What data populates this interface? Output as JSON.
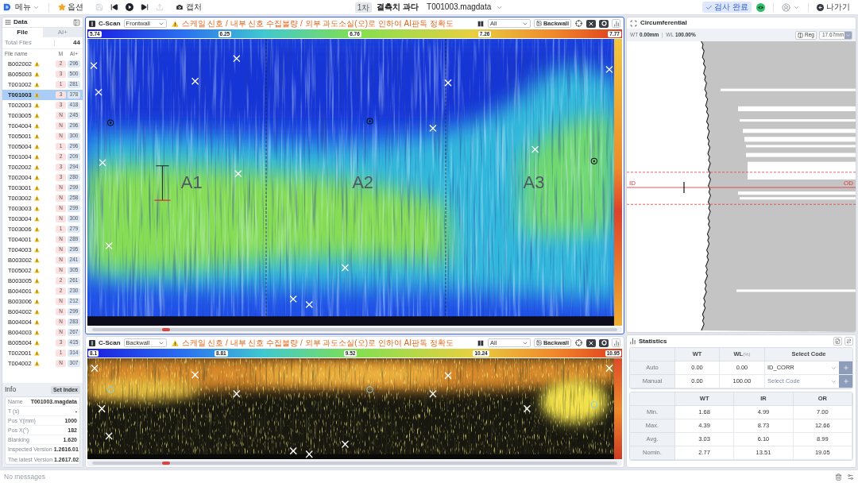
{
  "top_bar": {
    "menu_label": "메뉴",
    "options_label": "옵션",
    "tools": [
      {
        "kind": "save",
        "disabled": true
      },
      {
        "kind": "first",
        "disabled": false
      },
      {
        "kind": "play",
        "disabled": false
      },
      {
        "kind": "last",
        "disabled": false
      },
      {
        "kind": "export",
        "disabled": true
      }
    ],
    "capture_label": "캡처",
    "round_badge": "1차",
    "status_title": "결측치 과다",
    "file_name": "T001003.magdata",
    "complete_button": "검사 완료",
    "exit_button": "나가기"
  },
  "data_panel": {
    "title": "Data",
    "tabs": [
      {
        "label": "File",
        "selected": true
      },
      {
        "label": "AI+",
        "selected": false
      }
    ],
    "total_label": "Total Files",
    "total_count": "44",
    "columns": [
      "File name",
      "M",
      "AI+"
    ],
    "files": [
      {
        "name": "B002002",
        "warning": true,
        "m": "2",
        "ai": "296",
        "selected": false
      },
      {
        "name": "B005003",
        "warning": true,
        "m": "3",
        "ai": "500",
        "selected": false
      },
      {
        "name": "T001002",
        "warning": true,
        "m": "1",
        "ai": "281",
        "selected": false
      },
      {
        "name": "T001003",
        "warning": true,
        "m": "3",
        "ai": "378",
        "selected": true
      },
      {
        "name": "T002003",
        "warning": true,
        "m": "3",
        "ai": "418",
        "selected": false
      },
      {
        "name": "T003005",
        "warning": true,
        "m": "N",
        "ai": "245",
        "selected": false
      },
      {
        "name": "T004004",
        "warning": true,
        "m": "N",
        "ai": "296",
        "selected": false
      },
      {
        "name": "T005001",
        "warning": true,
        "m": "N",
        "ai": "300",
        "selected": false
      },
      {
        "name": "T005004",
        "warning": true,
        "m": "1",
        "ai": "296",
        "selected": false
      },
      {
        "name": "T001004",
        "warning": true,
        "m": "2",
        "ai": "209",
        "selected": false
      },
      {
        "name": "T002002",
        "warning": true,
        "m": "3",
        "ai": "294",
        "selected": false
      },
      {
        "name": "T002004",
        "warning": true,
        "m": "3",
        "ai": "280",
        "selected": false
      },
      {
        "name": "T003001",
        "warning": true,
        "m": "N",
        "ai": "299",
        "selected": false
      },
      {
        "name": "T003002",
        "warning": true,
        "m": "N",
        "ai": "258",
        "selected": false
      },
      {
        "name": "T003003",
        "warning": true,
        "m": "N",
        "ai": "299",
        "selected": false
      },
      {
        "name": "T003004",
        "warning": true,
        "m": "N",
        "ai": "300",
        "selected": false
      },
      {
        "name": "T003006",
        "warning": true,
        "m": "1",
        "ai": "279",
        "selected": false
      },
      {
        "name": "T004001",
        "warning": true,
        "m": "N",
        "ai": "289",
        "selected": false
      },
      {
        "name": "T004003",
        "warning": true,
        "m": "N",
        "ai": "295",
        "selected": false
      },
      {
        "name": "B003002",
        "warning": true,
        "m": "N",
        "ai": "241",
        "selected": false
      },
      {
        "name": "T005002",
        "warning": true,
        "m": "N",
        "ai": "305",
        "selected": false
      },
      {
        "name": "B003005",
        "warning": true,
        "m": "2",
        "ai": "261",
        "selected": false
      },
      {
        "name": "B004001",
        "warning": true,
        "m": "2",
        "ai": "230",
        "selected": false
      },
      {
        "name": "B003006",
        "warning": true,
        "m": "N",
        "ai": "212",
        "selected": false
      },
      {
        "name": "B004002",
        "warning": true,
        "m": "N",
        "ai": "299",
        "selected": false
      },
      {
        "name": "B004004",
        "warning": true,
        "m": "N",
        "ai": "283",
        "selected": false
      },
      {
        "name": "B004003",
        "warning": true,
        "m": "N",
        "ai": "267",
        "selected": false
      },
      {
        "name": "B005004",
        "warning": true,
        "m": "3",
        "ai": "415",
        "selected": false
      },
      {
        "name": "T002001",
        "warning": true,
        "m": "1",
        "ai": "314",
        "selected": false
      },
      {
        "name": "T004002",
        "warning": true,
        "m": "N",
        "ai": "307",
        "selected": false
      }
    ]
  },
  "info": {
    "title": "Info",
    "button": "Set Index",
    "rows": [
      {
        "label": "Name",
        "value": "T001003.magdata"
      },
      {
        "label": "T (s)",
        "value": "-"
      },
      {
        "label": "Pos Y(mm)",
        "value": "1000"
      },
      {
        "label": "Pos X(°)",
        "value": "182"
      },
      {
        "label": "Blanking",
        "value": "1.620"
      },
      {
        "label": "Inspected Version",
        "value": "1.2616.01"
      },
      {
        "label": "The latest Version",
        "value": "1.2617.02"
      }
    ]
  },
  "c_scans": [
    {
      "title": "C-Scan",
      "mode": "Frontwall",
      "warning": "스케일 신호 / 내부 신호 수집불량 / 외부 과도소실(오)로 인하여 AI판독 정확도",
      "filter": "All",
      "toggle_button": "Backwall",
      "active": true,
      "kind": "cool",
      "scale": [
        "5.74",
        "6.25",
        "6.76",
        "7.26",
        "7.77"
      ],
      "zones": [
        "A1",
        "A2",
        "A3"
      ]
    },
    {
      "title": "C-Scan",
      "mode": "Backwall",
      "warning": "스케일 신호 / 내부 신호 수집불량 / 외부 과도소실(오)로 인하여 AI판독 정확도",
      "filter": "All",
      "toggle_button": "Backwall",
      "active": false,
      "kind": "warm",
      "scale": [
        "8.1",
        "8.81",
        "9.52",
        "10.24",
        "10.95"
      ]
    }
  ],
  "circumferential": {
    "title": "Circumferential",
    "wt_label": "WT",
    "wt_value": "0.00mm",
    "wl_label": "WL",
    "wl_value": "100.00%",
    "reg_button": "Reg",
    "depth_value": "17.67mm",
    "inner_label": "ID",
    "outer_label": "OD"
  },
  "statistics": {
    "title": "Statistics",
    "code_table": {
      "columns": [
        {
          "label": "WT"
        },
        {
          "label": "WL",
          "unit": "(%)"
        },
        {
          "label": "Select Code"
        }
      ],
      "rows": [
        {
          "label": "Auto",
          "wt": "0.00",
          "wl": "0.00",
          "code": "ID_CORR"
        },
        {
          "label": "Manual",
          "wt": "0.00",
          "wl": "100.00",
          "placeholder": "Select Code"
        }
      ]
    },
    "summary_table": {
      "columns": [
        "WT",
        "IR",
        "OR"
      ],
      "rows": [
        {
          "label": "Min.",
          "values": [
            "1.68",
            "4.99",
            "7.00"
          ]
        },
        {
          "label": "Max.",
          "values": [
            "4.39",
            "8.73",
            "12.66"
          ]
        },
        {
          "label": "Avg.",
          "values": [
            "3.03",
            "6.10",
            "8.99"
          ]
        },
        {
          "label": "Nomin.",
          "values": [
            "2.77",
            "13.51",
            "19.05"
          ]
        }
      ]
    }
  },
  "status_bar": {
    "message": "No messages"
  }
}
